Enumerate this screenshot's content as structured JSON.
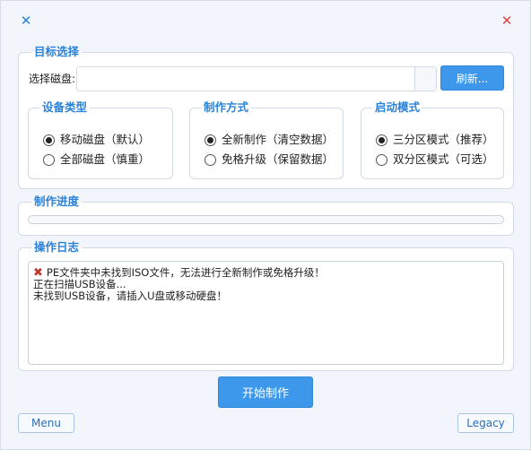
{
  "titlebar": {
    "left_icon": "close-icon-blue",
    "right_icon": "close-icon-red"
  },
  "target": {
    "title": "目标选择",
    "disk_label": "选择磁盘:",
    "disk_value": "",
    "refresh_label": "刷新..."
  },
  "device_type": {
    "title": "设备类型",
    "options": [
      "移动磁盘（默认）",
      "全部磁盘（慎重）"
    ],
    "selected": 0
  },
  "make_mode": {
    "title": "制作方式",
    "options": [
      "全新制作（清空数据）",
      "免格升级（保留数据）"
    ],
    "selected": 0
  },
  "boot_mode": {
    "title": "启动模式",
    "options": [
      "三分区模式（推荐）",
      "双分区模式（可选）"
    ],
    "selected": 0
  },
  "progress": {
    "title": "制作进度",
    "value": 0
  },
  "log": {
    "title": "操作日志",
    "lines": [
      "PE文件夹中未找到ISO文件，无法进行全新制作或免格升级！",
      "正在扫描USB设备...",
      "未找到USB设备，请插入U盘或移动硬盘！"
    ]
  },
  "actions": {
    "start_label": "开始制作",
    "menu_label": "Menu",
    "legacy_label": "Legacy"
  },
  "colors": {
    "accent": "#3d97ea",
    "title_blue": "#2b82d9",
    "error_red": "#c0392b"
  }
}
